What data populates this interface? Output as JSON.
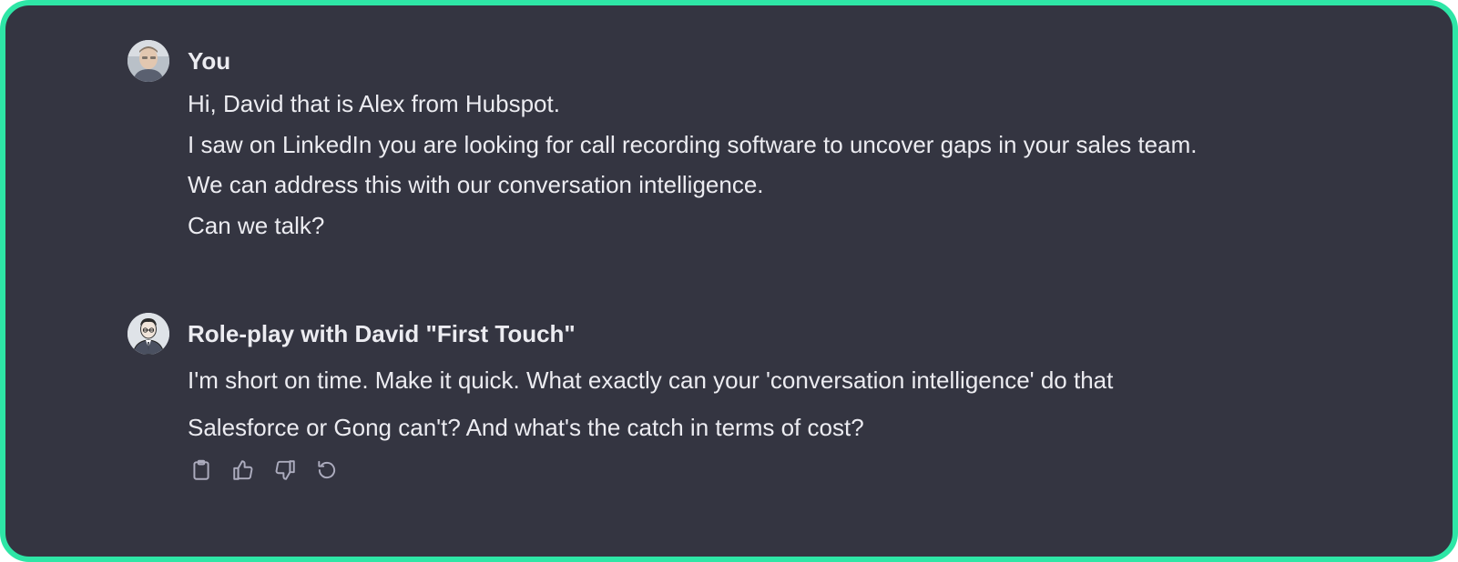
{
  "conversation": {
    "messages": [
      {
        "author": "You",
        "avatar_icon": "user-photo-avatar",
        "lines": [
          "Hi, David that is Alex from Hubspot.",
          "I saw on LinkedIn you are looking for call recording software to uncover gaps in your sales team.",
          "We can address this with our conversation intelligence.",
          "Can we talk?"
        ]
      },
      {
        "author": "Role-play with David \"First Touch\"",
        "avatar_icon": "david-persona-avatar",
        "lines": [
          "I'm short on time. Make it quick. What exactly can your 'conversation intelligence' do that",
          "Salesforce or Gong can't? And what's the catch in terms of cost?"
        ]
      }
    ],
    "actions": [
      {
        "icon": "clipboard-icon"
      },
      {
        "icon": "thumbs-up-icon"
      },
      {
        "icon": "thumbs-down-icon"
      },
      {
        "icon": "regenerate-icon"
      }
    ]
  },
  "colors": {
    "frame_border": "#2ee6a6",
    "background": "#343541",
    "text": "#ececf1",
    "icon": "#acacbe"
  }
}
